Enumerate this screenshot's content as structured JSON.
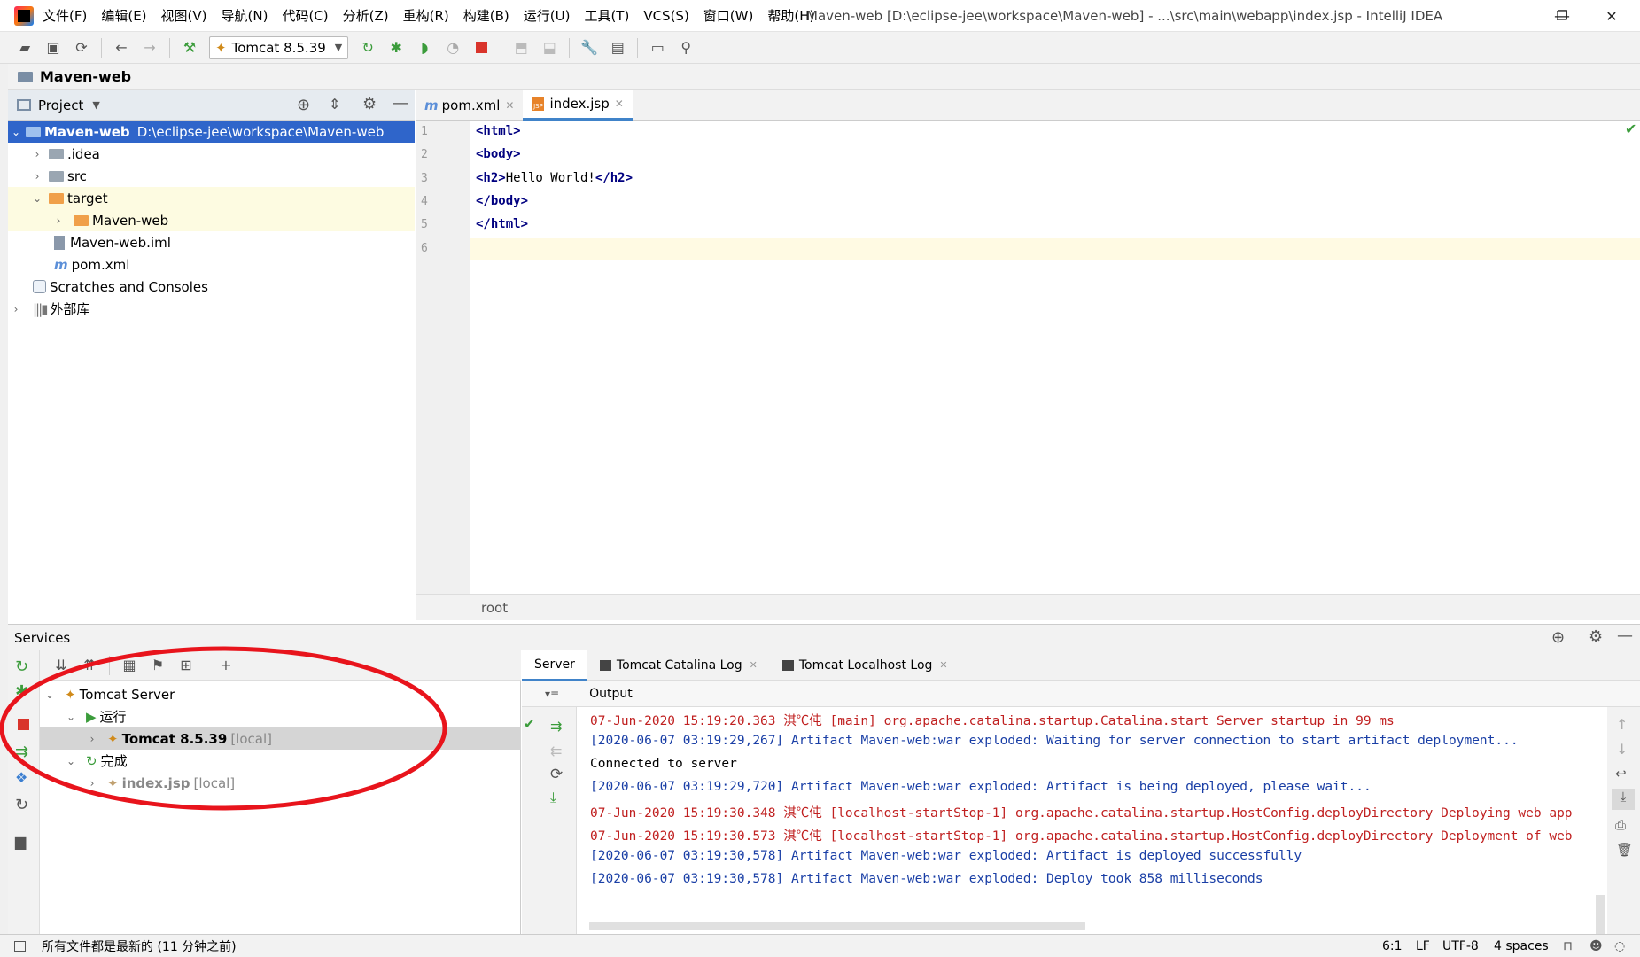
{
  "window": {
    "title": "Maven-web [D:\\eclipse-jee\\workspace\\Maven-web] - ...\\src\\main\\webapp\\index.jsp - IntelliJ IDEA",
    "minimize": "—",
    "restore": "❐",
    "close": "✕"
  },
  "menu": [
    "文件(F)",
    "编辑(E)",
    "视图(V)",
    "导航(N)",
    "代码(C)",
    "分析(Z)",
    "重构(R)",
    "构建(B)",
    "运行(U)",
    "工具(T)",
    "VCS(S)",
    "窗口(W)",
    "帮助(H)"
  ],
  "toolbar": {
    "run_config": "Tomcat 8.5.39"
  },
  "breadcrumb": "Maven-web",
  "project_panel": {
    "title": "Project",
    "tree": [
      {
        "label": "Maven-web",
        "path": "D:\\eclipse-jee\\workspace\\Maven-web"
      },
      {
        "label": ".idea"
      },
      {
        "label": "src"
      },
      {
        "label": "target"
      },
      {
        "label": "Maven-web"
      },
      {
        "label": "Maven-web.iml"
      },
      {
        "label": "pom.xml"
      },
      {
        "label": "Scratches and Consoles"
      },
      {
        "label": "外部库"
      }
    ]
  },
  "editor": {
    "tabs": [
      {
        "label": "pom.xml"
      },
      {
        "label": "index.jsp"
      }
    ],
    "line_numbers": [
      "1",
      "2",
      "3",
      "4",
      "5",
      "6"
    ],
    "code": {
      "l1": "<html>",
      "l2": "<body>",
      "l3_open": "<h2>",
      "l3_text": "Hello World!",
      "l3_close": "</h2>",
      "l4": "</body>",
      "l5": "</html>"
    },
    "status": "root"
  },
  "services": {
    "title": "Services",
    "tree": [
      {
        "label": "Tomcat Server"
      },
      {
        "label": "运行"
      },
      {
        "label": "Tomcat 8.5.39",
        "suffix": "[local]"
      },
      {
        "label": "完成"
      },
      {
        "label": "index.jsp",
        "suffix": "[local]"
      }
    ],
    "tabs": [
      "Server",
      "Tomcat Catalina Log",
      "Tomcat Localhost Log"
    ],
    "output_label": "Output",
    "output_lines": [
      {
        "text": "07-Jun-2020 15:19:20.363 淇℃伅 [main] org.apache.catalina.startup.Catalina.start Server startup in 99 ms",
        "color": "#c02020"
      },
      {
        "text": "[2020-06-07 03:19:29,267] Artifact Maven-web:war exploded: Waiting for server connection to start artifact deployment...",
        "color": "#1a3fa6"
      },
      {
        "text": "Connected to server",
        "color": "#000000"
      },
      {
        "text": "[2020-06-07 03:19:29,720] Artifact Maven-web:war exploded: Artifact is being deployed, please wait...",
        "color": "#1a3fa6"
      },
      {
        "text": "07-Jun-2020 15:19:30.348 淇℃伅 [localhost-startStop-1] org.apache.catalina.startup.HostConfig.deployDirectory Deploying web app",
        "color": "#c02020"
      },
      {
        "text": "07-Jun-2020 15:19:30.573 淇℃伅 [localhost-startStop-1] org.apache.catalina.startup.HostConfig.deployDirectory Deployment of web",
        "color": "#c02020"
      },
      {
        "text": "[2020-06-07 03:19:30,578] Artifact Maven-web:war exploded: Artifact is deployed successfully",
        "color": "#1a3fa6"
      },
      {
        "text": "[2020-06-07 03:19:30,578] Artifact Maven-web:war exploded: Deploy took 858 milliseconds",
        "color": "#1a3fa6"
      }
    ]
  },
  "statusbar": {
    "message": "所有文件都是最新的 (11 分钟之前)",
    "position": "6:1",
    "line_sep": "LF",
    "encoding": "UTF-8",
    "indent": "4 spaces"
  },
  "colors": {
    "selection": "#2f65ca",
    "annotation": "#e8141c",
    "run_green": "#3b9c3b"
  }
}
